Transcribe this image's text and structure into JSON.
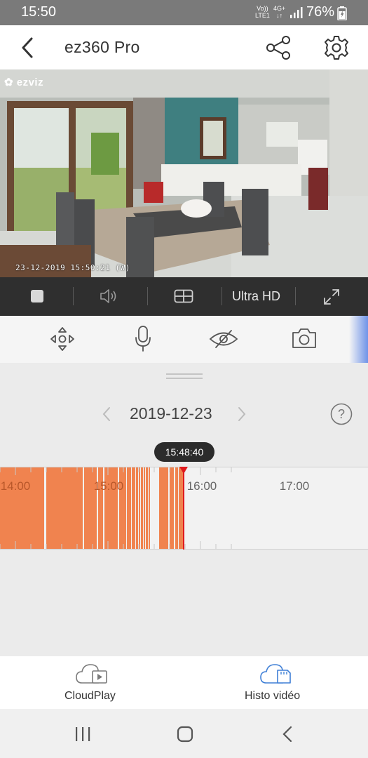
{
  "status_bar": {
    "time": "15:50",
    "net_volte_1": "Vo))",
    "net_volte_2": "LTE1",
    "net_gen": "4G+",
    "battery": "76%"
  },
  "header": {
    "title": "ez360 Pro"
  },
  "video": {
    "brand": "ezviz",
    "osd_timestamp": "23-12-2019 15:50:21  (W)"
  },
  "video_controls": {
    "quality": "Ultra HD"
  },
  "timeline": {
    "date": "2019-12-23",
    "current_time": "15:48:40",
    "hour_labels": [
      "14:00",
      "15:00",
      "16:00",
      "17:00"
    ],
    "colors": {
      "recording": "#f0834f",
      "cursor": "#e0191d"
    }
  },
  "tabs": {
    "cloudplay": "CloudPlay",
    "histo": "Histo vidéo"
  },
  "icons": {
    "back": "back-arrow-icon",
    "share": "share-icon",
    "settings": "gear-icon",
    "stop": "stop-icon",
    "sound": "speaker-icon",
    "multiview": "grid-icon",
    "fullscreen": "expand-icon",
    "ptz": "ptz-direction-icon",
    "mic": "microphone-icon",
    "privacy": "eye-slash-icon",
    "snapshot": "camera-icon",
    "help": "question-icon",
    "cloud": "cloud-video-icon",
    "sd": "cloud-sd-icon"
  }
}
